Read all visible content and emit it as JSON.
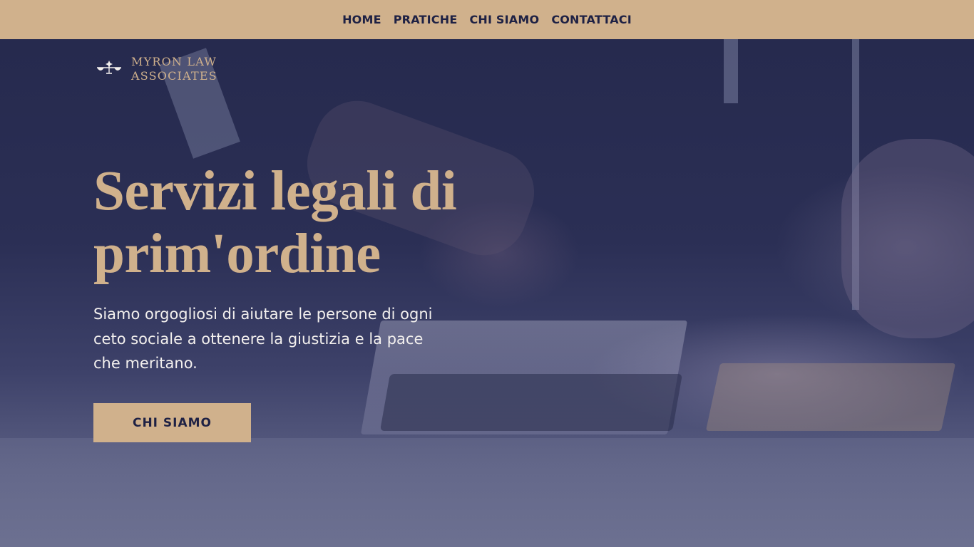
{
  "nav": {
    "items": [
      {
        "label": "HOME"
      },
      {
        "label": "PRATICHE"
      },
      {
        "label": "CHI SIAMO"
      },
      {
        "label": "CONTATTACI"
      }
    ]
  },
  "brand": {
    "line1": "MYRON LAW",
    "line2": "ASSOCIATES",
    "icon": "scales-of-justice-icon"
  },
  "hero": {
    "headline_line1": "Servizi legali di",
    "headline_line2": "prim'ordine",
    "description": "Siamo orgogliosi di aiutare le persone di ogni ceto sociale a ottenere la giustizia e la pace che meritano.",
    "cta_label": "CHI SIAMO"
  },
  "colors": {
    "accent": "#d0b18c",
    "navy": "#1e2144",
    "overlay": "#2f3358",
    "text_light": "#f3f0ee"
  }
}
